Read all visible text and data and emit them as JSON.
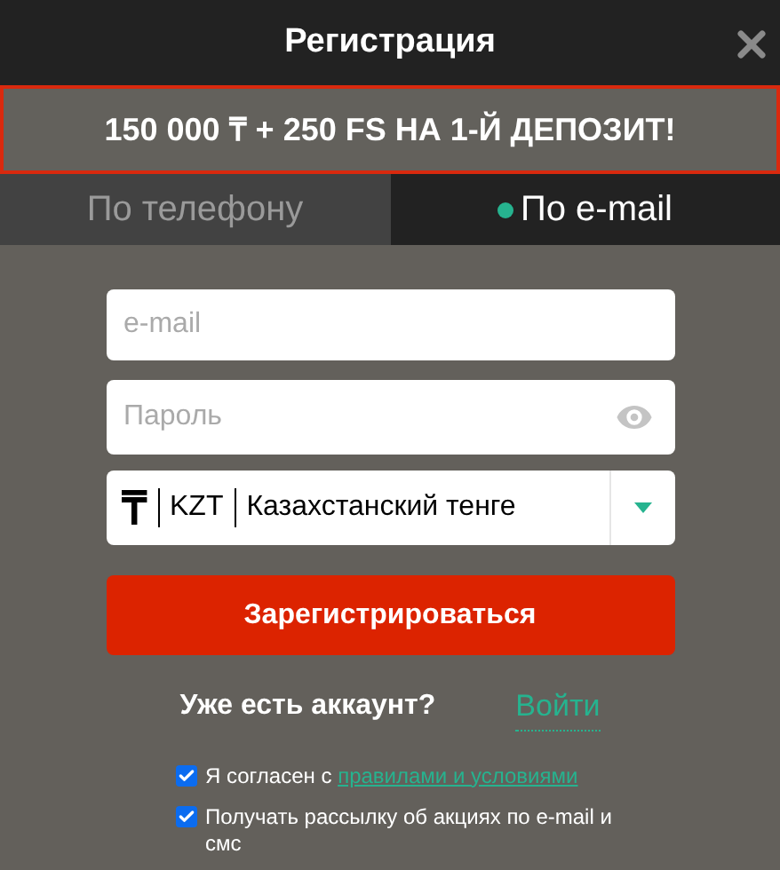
{
  "title": "Регистрация",
  "promo": "150 000 ₸ + 250 FS НА 1-Й ДЕПОЗИТ!",
  "tabs": [
    {
      "label": "По телефону",
      "selected": false
    },
    {
      "label": "По e-mail",
      "selected": true
    }
  ],
  "email": {
    "placeholder": "e-mail"
  },
  "password": {
    "placeholder": "Пароль"
  },
  "currency": {
    "symbol": "₸",
    "code": "KZT",
    "name": "Казахстанский тенге"
  },
  "submit": "Зарегистрироваться",
  "login_prompt": "Уже есть аккаунт?",
  "login_link": "Войти",
  "checkboxes": [
    {
      "text": "Я согласен с",
      "link": "правилами и условиями",
      "checked": true
    },
    {
      "text": "Получать рассылку об акциях по e-mail и смс",
      "checked": true
    }
  ]
}
